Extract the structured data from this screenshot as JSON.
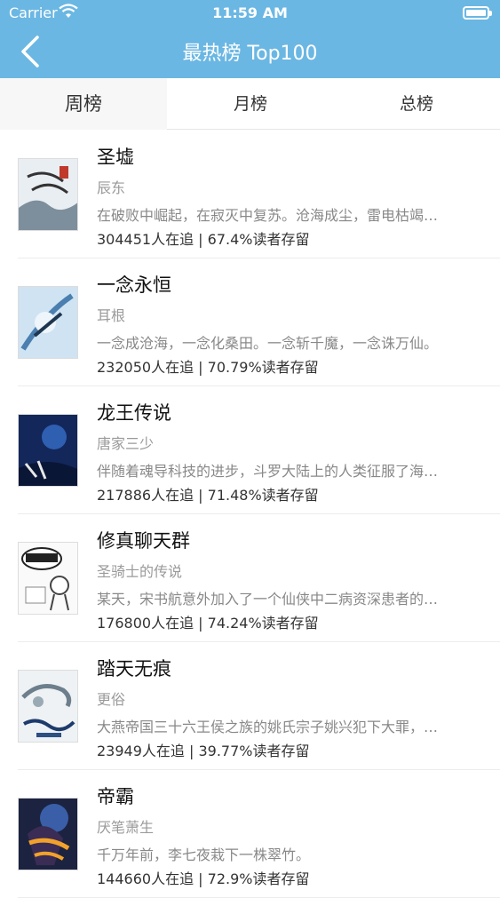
{
  "status_bar": {
    "carrier": "Carrier",
    "time": "11:59 AM"
  },
  "nav": {
    "title": "最热榜 Top100",
    "back_icon": "chevron-left-icon"
  },
  "tabs": [
    {
      "label": "周榜",
      "selected": true
    },
    {
      "label": "月榜",
      "selected": false
    },
    {
      "label": "总榜",
      "selected": false
    }
  ],
  "books": [
    {
      "title": "圣墟",
      "author": "辰东",
      "description": "在破败中崛起，在寂灭中复苏。沧海成尘，雷电枯竭…",
      "stats": "304451人在追 | 67.4%读者存留"
    },
    {
      "title": "一念永恒",
      "author": "耳根",
      "description": "一念成沧海，一念化桑田。一念斩千魔，一念诛万仙。",
      "stats": "232050人在追 | 70.79%读者存留"
    },
    {
      "title": "龙王传说",
      "author": "唐家三少",
      "description": "伴随着魂导科技的进步，斗罗大陆上的人类征服了海…",
      "stats": "217886人在追 | 71.48%读者存留"
    },
    {
      "title": "修真聊天群",
      "author": "圣骑士的传说",
      "description": "某天，宋书航意外加入了一个仙侠中二病资深患者的…",
      "stats": "176800人在追 | 74.24%读者存留"
    },
    {
      "title": "踏天无痕",
      "author": "更俗",
      "description": "大燕帝国三十六王侯之族的姚氏宗子姚兴犯下大罪，…",
      "stats": "23949人在追 | 39.77%读者存留"
    },
    {
      "title": "帝霸",
      "author": "厌笔萧生",
      "description": "千万年前，李七夜栽下一株翠竹。",
      "stats": "144660人在追 | 72.9%读者存留"
    }
  ],
  "colors": {
    "header": "#6bb7e3",
    "tab_selected_bg": "#f7f7f7"
  }
}
